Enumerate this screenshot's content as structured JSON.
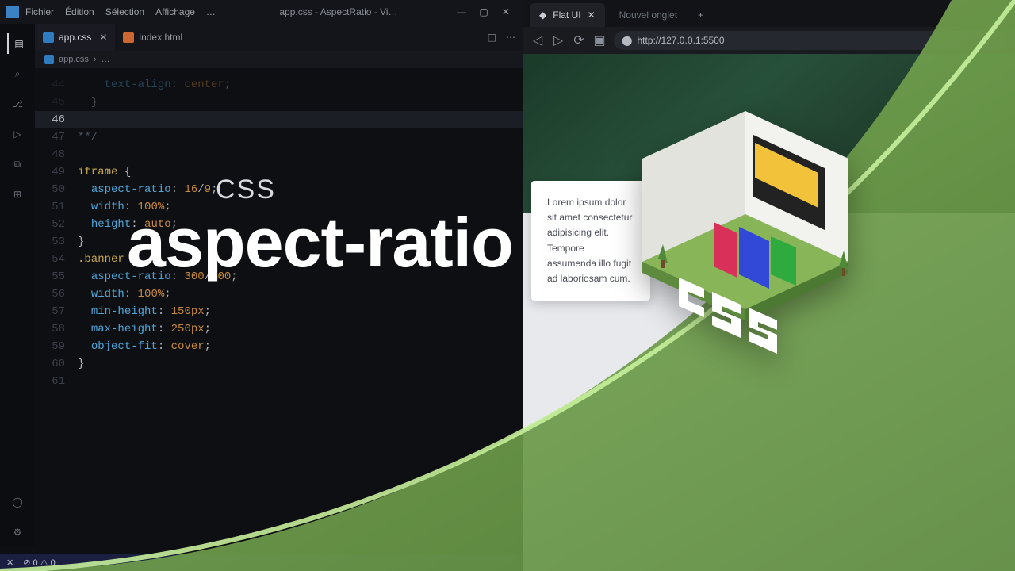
{
  "vscode": {
    "titlebar": {
      "menu": [
        "Fichier",
        "Édition",
        "Sélection",
        "Affichage",
        "…"
      ],
      "title": "app.css - AspectRatio - Vi…",
      "winbtns": [
        "—",
        "▢",
        "✕"
      ]
    },
    "tabs": [
      {
        "label": "app.css",
        "icon": "css",
        "active": true,
        "dirty": false
      },
      {
        "label": "index.html",
        "icon": "html",
        "active": false,
        "dirty": false
      }
    ],
    "crumbs": {
      "file": "app.css",
      "sep": "›",
      "extra": "…"
    },
    "lines": [
      {
        "n": 44,
        "html": "    <span class='c-prop'>text-align</span><span class='c-punc'>:</span> <span class='c-kw'>center</span><span class='c-punc'>;</span>",
        "cm": true
      },
      {
        "n": 45,
        "html": "  <span class='c-punc'>}</span>",
        "cm": true
      },
      {
        "n": 46,
        "html": " ",
        "cur": true
      },
      {
        "n": 47,
        "html": "<span class='c-cm'>**/</span>"
      },
      {
        "n": 48,
        "html": " "
      },
      {
        "n": 49,
        "html": "<span class='c-sel'>iframe</span> <span class='c-punc'>{</span>"
      },
      {
        "n": 50,
        "html": "  <span class='c-prop'>aspect-ratio</span><span class='c-punc'>:</span> <span class='c-num'>16</span><span class='c-punc'>/</span><span class='c-num'>9</span><span class='c-punc'>;</span>"
      },
      {
        "n": 51,
        "html": "  <span class='c-prop'>width</span><span class='c-punc'>:</span> <span class='c-num'>100</span><span class='c-unit'>%</span><span class='c-punc'>;</span>"
      },
      {
        "n": 52,
        "html": "  <span class='c-prop'>height</span><span class='c-punc'>:</span> <span class='c-kw'>auto</span><span class='c-punc'>;</span>"
      },
      {
        "n": 53,
        "html": "<span class='c-punc'>}</span>"
      },
      {
        "n": 54,
        "html": "<span class='c-sel'>.banner</span> <span class='c-punc'>{</span>"
      },
      {
        "n": 55,
        "html": "  <span class='c-prop'>aspect-ratio</span><span class='c-punc'>:</span> <span class='c-num'>300</span><span class='c-punc'>/</span><span class='c-num'>100</span><span class='c-punc'>;</span>"
      },
      {
        "n": 56,
        "html": "  <span class='c-prop'>width</span><span class='c-punc'>:</span> <span class='c-num'>100</span><span class='c-unit'>%</span><span class='c-punc'>;</span>"
      },
      {
        "n": 57,
        "html": "  <span class='c-prop'>min-height</span><span class='c-punc'>:</span> <span class='c-num'>150</span><span class='c-unit'>px</span><span class='c-punc'>;</span>"
      },
      {
        "n": 58,
        "html": "  <span class='c-prop'>max-height</span><span class='c-punc'>:</span> <span class='c-num'>250</span><span class='c-unit'>px</span><span class='c-punc'>;</span>"
      },
      {
        "n": 59,
        "html": "  <span class='c-prop'>object-fit</span><span class='c-punc'>:</span> <span class='c-kw'>cover</span><span class='c-punc'>;</span>"
      },
      {
        "n": 60,
        "html": "<span class='c-punc'>}</span>"
      },
      {
        "n": 61,
        "html": " "
      }
    ],
    "statusbar": {
      "branch": "✕",
      "errs": "⊘ 0 ⚠ 0"
    }
  },
  "browser": {
    "tabs": [
      {
        "label": "Flat UI",
        "active": true,
        "fav": "◆"
      },
      {
        "label": "Nouvel onglet",
        "active": false
      }
    ],
    "plus": "+",
    "url": "http://127.0.0.1:5500",
    "lock": "⬤",
    "para": "Lorem ipsum dolor sit amet consectetur adipisicing elit. Tempore assumenda illo fugit ad laboriosam cum."
  },
  "overlay": {
    "small": "CSS",
    "big": "aspect-ratio"
  },
  "colors": {
    "green": "#6e9a4b",
    "greenEdge": "#b7e08b"
  }
}
